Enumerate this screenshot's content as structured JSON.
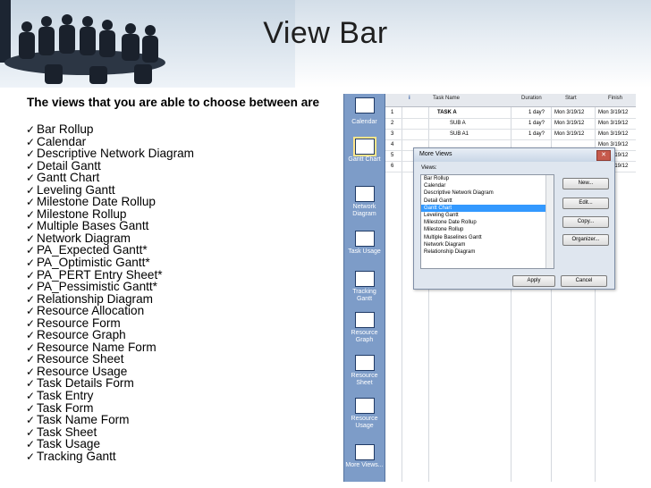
{
  "title": "View Bar",
  "intro": "The views that you are able to choose between are",
  "views": [
    "Bar Rollup",
    "Calendar",
    "Descriptive Network Diagram",
    "Detail Gantt",
    "Gantt Chart",
    "Leveling Gantt",
    "Milestone Date Rollup",
    "Milestone Rollup",
    "Multiple Bases Gantt",
    "Network Diagram",
    "PA_Expected Gantt*",
    "PA_Optimistic Gantt*",
    "PA_PERT Entry Sheet*",
    "PA_Pessimistic Gantt*",
    "Relationship Diagram",
    "Resource Allocation",
    "Resource Form",
    "Resource Graph",
    "Resource Name Form",
    "Resource Sheet",
    "Resource Usage",
    "Task Details Form",
    "Task Entry",
    "Task Form",
    "Task Name Form",
    "Task Sheet",
    "Task Usage",
    "Tracking Gantt"
  ],
  "viewbar": {
    "items": [
      {
        "label": "Calendar"
      },
      {
        "label": "Gantt Chart"
      },
      {
        "label": "Network Diagram"
      },
      {
        "label": "Task Usage"
      },
      {
        "label": "Tracking Gantt"
      },
      {
        "label": "Resource Graph"
      },
      {
        "label": "Resource Sheet"
      },
      {
        "label": "Resource Usage"
      },
      {
        "label": "More Views..."
      }
    ]
  },
  "grid": {
    "headers": {
      "info": "i",
      "task_name": "Task Name",
      "duration": "Duration",
      "start": "Start",
      "finish": "Finish"
    },
    "rows": [
      {
        "id": "1",
        "name": "TASK A",
        "duration": "1 day?",
        "start": "Mon 3/19/12",
        "finish": "Mon 3/19/12"
      },
      {
        "id": "2",
        "name": "SUB A",
        "duration": "1 day?",
        "start": "Mon 3/19/12",
        "finish": "Mon 3/19/12"
      },
      {
        "id": "3",
        "name": "SUB A1",
        "duration": "1 day?",
        "start": "Mon 3/19/12",
        "finish": "Mon 3/19/12"
      },
      {
        "id": "4",
        "name": "",
        "duration": "",
        "start": "",
        "finish": "Mon 3/19/12"
      },
      {
        "id": "5",
        "name": "",
        "duration": "",
        "start": "",
        "finish": "Mon 3/19/12"
      },
      {
        "id": "6",
        "name": "",
        "duration": "",
        "start": "",
        "finish": "Mon 3/19/12"
      }
    ]
  },
  "dialog": {
    "title": "More Views",
    "close": "✕",
    "views_label": "Views:",
    "items": [
      "Bar Rollup",
      "Calendar",
      "Descriptive Network Diagram",
      "Detail Gantt",
      "Gantt Chart",
      "Leveling Gantt",
      "Milestone Date Rollup",
      "Milestone Rollup",
      "Multiple Baselines Gantt",
      "Network Diagram",
      "Relationship Diagram"
    ],
    "selected": "Gantt Chart",
    "buttons": {
      "new": "New...",
      "edit": "Edit...",
      "copy": "Copy...",
      "organizer": "Organizer...",
      "apply": "Apply",
      "cancel": "Cancel"
    }
  },
  "icons": {
    "checkmark": "checkmark-icon",
    "close": "close-icon"
  },
  "colors": {
    "viewbar": "#7d9cc8",
    "selected_item": "#3399ff"
  }
}
